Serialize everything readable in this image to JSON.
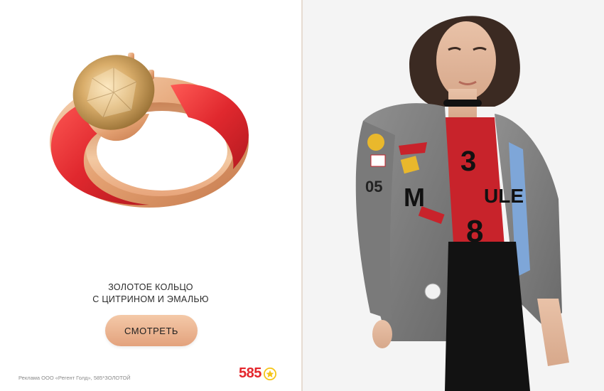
{
  "product": {
    "caption_line1": "ЗОЛОТОЕ КОЛЬЦО",
    "caption_line2": "С ЦИТРИНОМ И ЭМАЛЬЮ"
  },
  "cta": {
    "label": "СМОТРЕТЬ"
  },
  "footer": {
    "legal": "Реклама ООО «Регент Голд», 585*ЗОЛОТОЙ",
    "logo_text": "585"
  },
  "colors": {
    "brand_red": "#e4262c",
    "star_yellow": "#f5c518",
    "button_peach": "#eab08c",
    "enamel_red": "#e0282e",
    "gold": "#e7a878"
  },
  "icons": {
    "logo_star": "star-icon"
  }
}
